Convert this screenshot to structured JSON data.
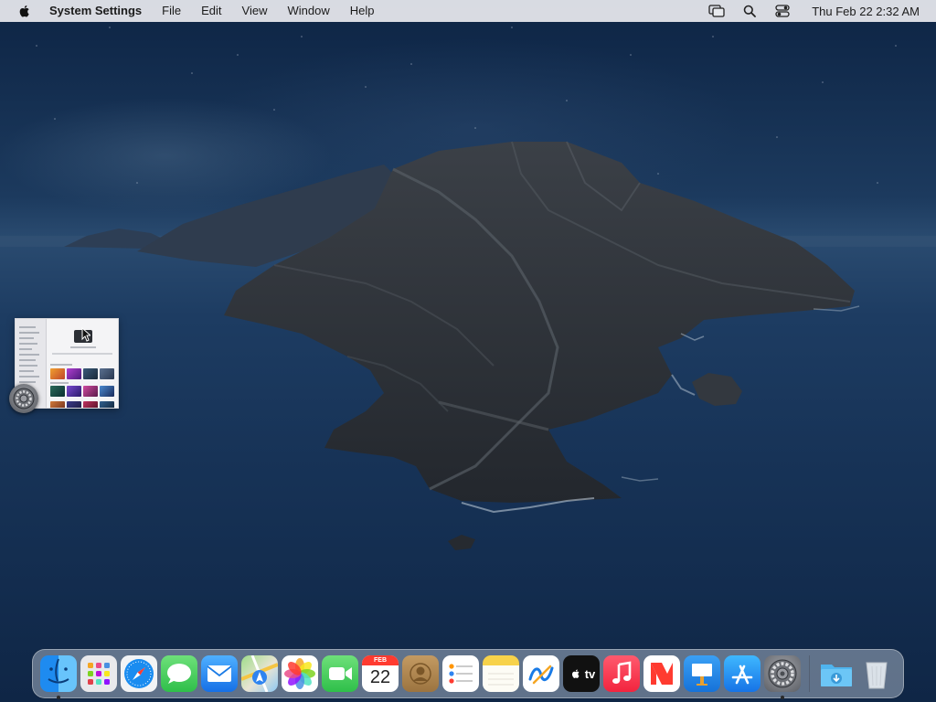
{
  "menubar": {
    "app_name": "System Settings",
    "menus": [
      "File",
      "Edit",
      "View",
      "Window",
      "Help"
    ],
    "clock": "Thu Feb 22  2:32 AM"
  },
  "minimized_window": {
    "app": "System Settings"
  },
  "dock": {
    "apps": [
      {
        "name": "Finder",
        "icon": "finder-icon",
        "running": true
      },
      {
        "name": "Launchpad",
        "icon": "launchpad-icon",
        "running": false
      },
      {
        "name": "Safari",
        "icon": "safari-icon",
        "running": false
      },
      {
        "name": "Messages",
        "icon": "messages-icon",
        "running": false
      },
      {
        "name": "Mail",
        "icon": "mail-icon",
        "running": false
      },
      {
        "name": "Maps",
        "icon": "maps-icon",
        "running": false
      },
      {
        "name": "Photos",
        "icon": "photos-icon",
        "running": false
      },
      {
        "name": "FaceTime",
        "icon": "facetime-icon",
        "running": false
      },
      {
        "name": "Calendar",
        "icon": "calendar-icon",
        "running": false,
        "month": "FEB",
        "day": "22"
      },
      {
        "name": "Contacts",
        "icon": "contacts-icon",
        "running": false
      },
      {
        "name": "Reminders",
        "icon": "reminders-icon",
        "running": false
      },
      {
        "name": "Notes",
        "icon": "notes-icon",
        "running": false
      },
      {
        "name": "Freeform",
        "icon": "freeform-icon",
        "running": false
      },
      {
        "name": "TV",
        "icon": "tv-icon",
        "running": false,
        "label": "tv"
      },
      {
        "name": "Music",
        "icon": "music-icon",
        "running": false
      },
      {
        "name": "News",
        "icon": "news-icon",
        "running": false
      },
      {
        "name": "Keynote",
        "icon": "keynote-icon",
        "running": false
      },
      {
        "name": "App Store",
        "icon": "app-store-icon",
        "running": false
      },
      {
        "name": "System Settings",
        "icon": "gear-icon",
        "running": true
      }
    ],
    "others": [
      {
        "name": "Downloads",
        "icon": "downloads-folder-icon"
      },
      {
        "name": "Trash",
        "icon": "trash-icon"
      }
    ]
  },
  "colors": {
    "menubar_bg": "#e8eaee",
    "sea": "#173357",
    "sky": "#0d2444"
  }
}
